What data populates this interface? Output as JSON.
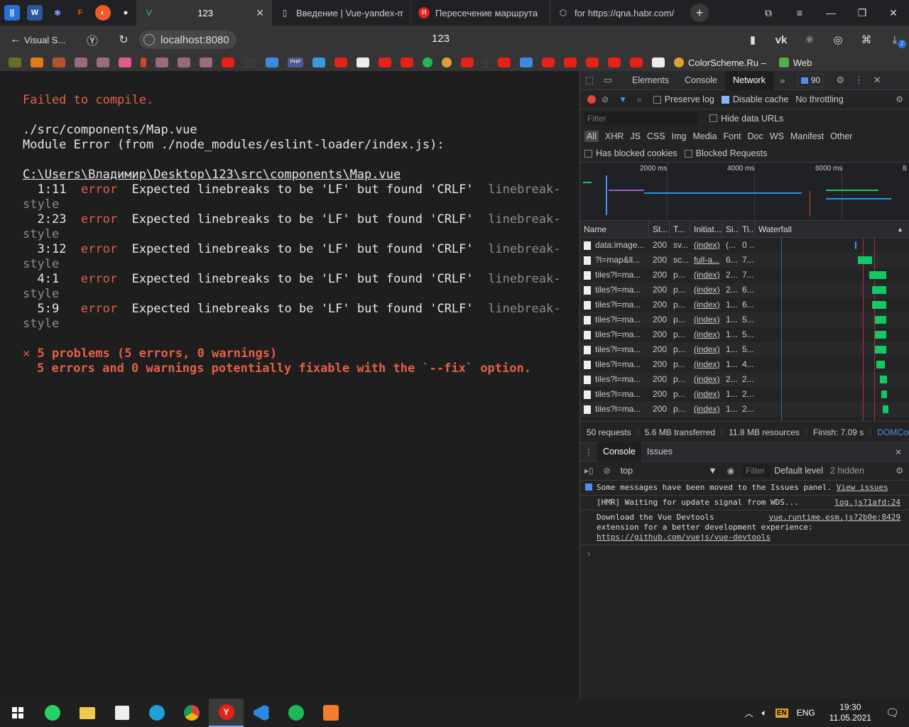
{
  "browser": {
    "tabs": [
      {
        "title": "123",
        "active": true
      },
      {
        "title": "Введение | Vue-yandex-m"
      },
      {
        "title": "Пересечение маршрута"
      },
      {
        "title": "for https://qna.habr.com/"
      }
    ],
    "back_label": "Visual S...",
    "url": "localhost:8080",
    "page_title": "123",
    "bookmarks": {
      "colorscheme": "ColorScheme.Ru –",
      "web": "Web",
      "php": "PHP"
    },
    "ext_badge": "2"
  },
  "overlay": {
    "title": "Failed to compile.",
    "file": "./src/components/Map.vue",
    "module_error": "Module Error (from ./node_modules/eslint-loader/index.js):",
    "path": "C:\\Users\\Владимир\\Desktop\\123\\src\\components\\Map.vue",
    "errors": [
      {
        "loc": "1:11",
        "level": "error",
        "message": "Expected linebreaks to be 'LF' but found 'CRLF'",
        "rule_a": "linebreak-",
        "rule_b": "style"
      },
      {
        "loc": "2:23",
        "level": "error",
        "message": "Expected linebreaks to be 'LF' but found 'CRLF'",
        "rule_a": "linebreak-",
        "rule_b": "style"
      },
      {
        "loc": "3:12",
        "level": "error",
        "message": "Expected linebreaks to be 'LF' but found 'CRLF'",
        "rule_a": "linebreak-",
        "rule_b": "style"
      },
      {
        "loc": "4:1",
        "level": "error",
        "message": "Expected linebreaks to be 'LF' but found 'CRLF'",
        "rule_a": "linebreak-",
        "rule_b": "style"
      },
      {
        "loc": "5:9",
        "level": "error",
        "message": "Expected linebreaks to be 'LF' but found 'CRLF'",
        "rule_a": "linebreak-",
        "rule_b": "style"
      }
    ],
    "summary": "✕ 5 problems (5 errors, 0 warnings)",
    "fixable": "5 errors and 0 warnings potentially fixable with the `--fix` option."
  },
  "devtools": {
    "tabs": [
      "Elements",
      "Console",
      "Network"
    ],
    "active_tab": "Network",
    "issues_count": "90",
    "preserve_log": "Preserve log",
    "disable_cache": "Disable cache",
    "throttling": "No throttling",
    "filter_placeholder": "Filter",
    "hide_data_urls": "Hide data URLs",
    "types": [
      "All",
      "XHR",
      "JS",
      "CSS",
      "Img",
      "Media",
      "Font",
      "Doc",
      "WS",
      "Manifest",
      "Other"
    ],
    "has_blocked_cookies": "Has blocked cookies",
    "blocked_requests": "Blocked Requests",
    "overview_ticks": [
      "2000 ms",
      "4000 ms",
      "6000 ms",
      "8"
    ],
    "columns": [
      "Name",
      "St...",
      "T...",
      "Initiat...",
      "Si...",
      "Ti...",
      "Waterfall"
    ],
    "rows": [
      {
        "name": "data:image...",
        "status": "200",
        "type": "sv...",
        "initiator": "(index)",
        "size": "(...",
        "time": "0 ...",
        "wf_start": 0.72,
        "wf_len": 0.01
      },
      {
        "name": "?l=map&ll...",
        "status": "200",
        "type": "sc...",
        "initiator": "full-a...",
        "size": "6...",
        "time": "7...",
        "wf_start": 0.74,
        "wf_len": 0.1
      },
      {
        "name": "tiles?l=ma...",
        "status": "200",
        "type": "p...",
        "initiator": "(index)",
        "size": "2...",
        "time": "7...",
        "wf_start": 0.82,
        "wf_len": 0.12
      },
      {
        "name": "tiles?l=ma...",
        "status": "200",
        "type": "p...",
        "initiator": "(index)",
        "size": "2...",
        "time": "6...",
        "wf_start": 0.84,
        "wf_len": 0.1
      },
      {
        "name": "tiles?l=ma...",
        "status": "200",
        "type": "p...",
        "initiator": "(index)",
        "size": "1...",
        "time": "6...",
        "wf_start": 0.84,
        "wf_len": 0.1
      },
      {
        "name": "tiles?l=ma...",
        "status": "200",
        "type": "p...",
        "initiator": "(index)",
        "size": "1...",
        "time": "5...",
        "wf_start": 0.86,
        "wf_len": 0.08
      },
      {
        "name": "tiles?l=ma...",
        "status": "200",
        "type": "p...",
        "initiator": "(index)",
        "size": "1...",
        "time": "5...",
        "wf_start": 0.86,
        "wf_len": 0.08
      },
      {
        "name": "tiles?l=ma...",
        "status": "200",
        "type": "p...",
        "initiator": "(index)",
        "size": "1...",
        "time": "5...",
        "wf_start": 0.86,
        "wf_len": 0.08
      },
      {
        "name": "tiles?l=ma...",
        "status": "200",
        "type": "p...",
        "initiator": "(index)",
        "size": "1...",
        "time": "4...",
        "wf_start": 0.87,
        "wf_len": 0.06
      },
      {
        "name": "tiles?l=ma...",
        "status": "200",
        "type": "p...",
        "initiator": "(index)",
        "size": "2...",
        "time": "2...",
        "wf_start": 0.9,
        "wf_len": 0.05
      },
      {
        "name": "tiles?l=ma...",
        "status": "200",
        "type": "p...",
        "initiator": "(index)",
        "size": "1...",
        "time": "2...",
        "wf_start": 0.91,
        "wf_len": 0.04
      },
      {
        "name": "tiles?l=ma...",
        "status": "200",
        "type": "p...",
        "initiator": "(index)",
        "size": "1...",
        "time": "2...",
        "wf_start": 0.92,
        "wf_len": 0.04
      }
    ],
    "summary": {
      "requests": "50 requests",
      "transferred": "5.6 MB transferred",
      "resources": "11.8 MB resources",
      "finish": "Finish: 7.09 s",
      "domcontent": "DOMCont"
    },
    "drawer_tabs": [
      "Console",
      "Issues"
    ],
    "context": "top",
    "console_filter": "Filter",
    "default_level": "Default level",
    "hidden": "2 hidden",
    "messages": [
      {
        "text": "Some messages have been moved to the Issues panel.",
        "link": "View issues"
      },
      {
        "text": "[HMR] Waiting for update signal from WDS...",
        "source": "log.js?1afd:24"
      },
      {
        "text": "Download the Vue Devtools",
        "line2": "extension for a better development experience:",
        "url": "https://github.com/vuejs/vue-devtools",
        "source": "vue.runtime.esm.js?2b0e:8429"
      }
    ],
    "prompt": "›"
  },
  "taskbar": {
    "lang_badge": "EN",
    "lang": "ENG",
    "time": "19:30",
    "date": "11.05.2021"
  },
  "colors": {
    "error": "#e36049",
    "accent": "#4d8ef0",
    "waterfall": "#14c866"
  }
}
